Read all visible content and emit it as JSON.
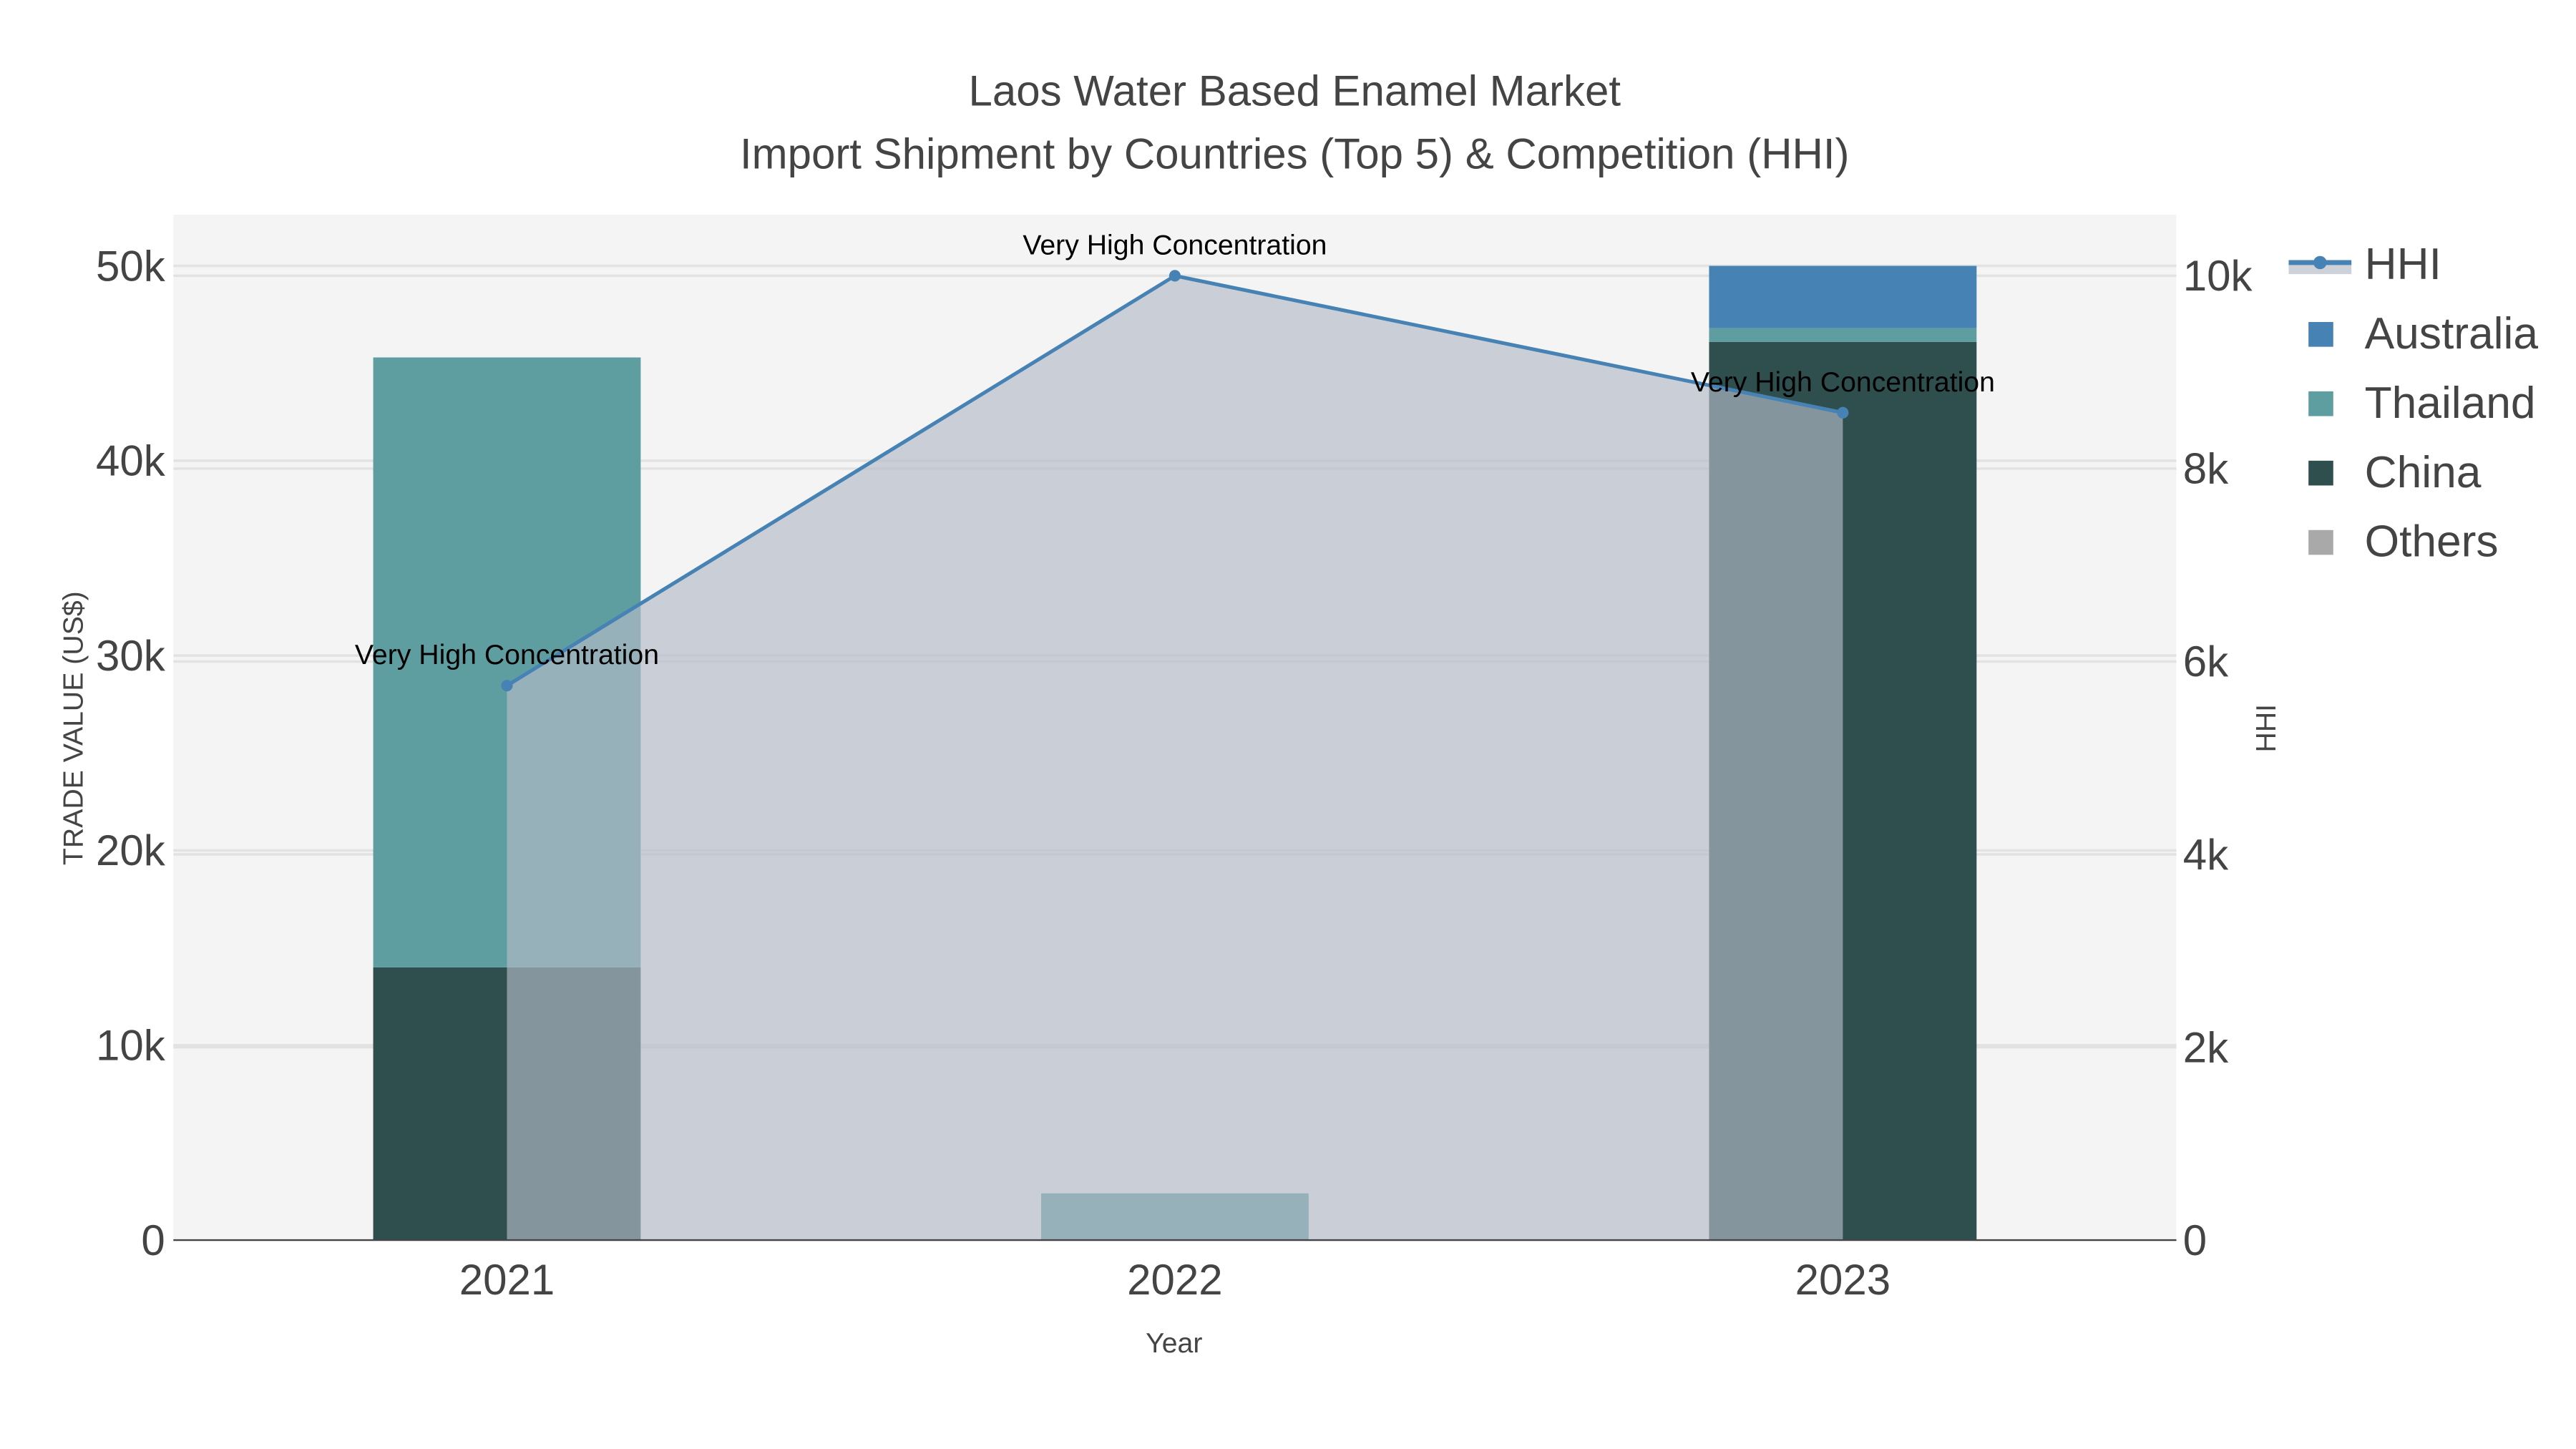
{
  "chart_data": {
    "type": "bar",
    "title": "Laos Water Based Enamel Market",
    "subtitle": "Import Shipment by Countries (Top 5) & Competition (HHI)",
    "xlabel": "Year",
    "ylabel": "TRADE VALUE (US$)",
    "y2label": "HHI",
    "categories": [
      "2021",
      "2022",
      "2023"
    ],
    "ylim": [
      0,
      52500
    ],
    "y2lim": [
      0,
      10500
    ],
    "yticks": [
      {
        "v": 0,
        "label": "0"
      },
      {
        "v": 10000,
        "label": "10k"
      },
      {
        "v": 20000,
        "label": "20k"
      },
      {
        "v": 30000,
        "label": "30k"
      },
      {
        "v": 40000,
        "label": "40k"
      },
      {
        "v": 50000,
        "label": "50k"
      }
    ],
    "y2ticks": [
      {
        "v": 0,
        "label": "0"
      },
      {
        "v": 2000,
        "label": "2k"
      },
      {
        "v": 4000,
        "label": "4k"
      },
      {
        "v": 6000,
        "label": "6k"
      },
      {
        "v": 8000,
        "label": "8k"
      },
      {
        "v": 10000,
        "label": "10k"
      }
    ],
    "barmode": "stack",
    "series": [
      {
        "name": "China",
        "color": "#2f4f4f",
        "values": [
          14000,
          0,
          46100
        ]
      },
      {
        "name": "Thailand",
        "color": "#5f9ea0",
        "values": [
          31300,
          2400,
          700
        ]
      },
      {
        "name": "Australia",
        "color": "#4682b4",
        "values": [
          0,
          0,
          3200
        ]
      },
      {
        "name": "Others",
        "color": "#a9a9a9",
        "values": [
          0,
          0,
          0
        ]
      }
    ],
    "hhi": {
      "name": "HHI",
      "color": "#4682b4",
      "values": [
        5750,
        10000,
        8580
      ],
      "labels": [
        "Very High Concentration",
        "Very High Concentration",
        "Very High Concentration"
      ]
    },
    "legend": [
      "HHI",
      "Australia",
      "Thailand",
      "China",
      "Others"
    ],
    "legend_position": "top-right",
    "grid": true
  }
}
